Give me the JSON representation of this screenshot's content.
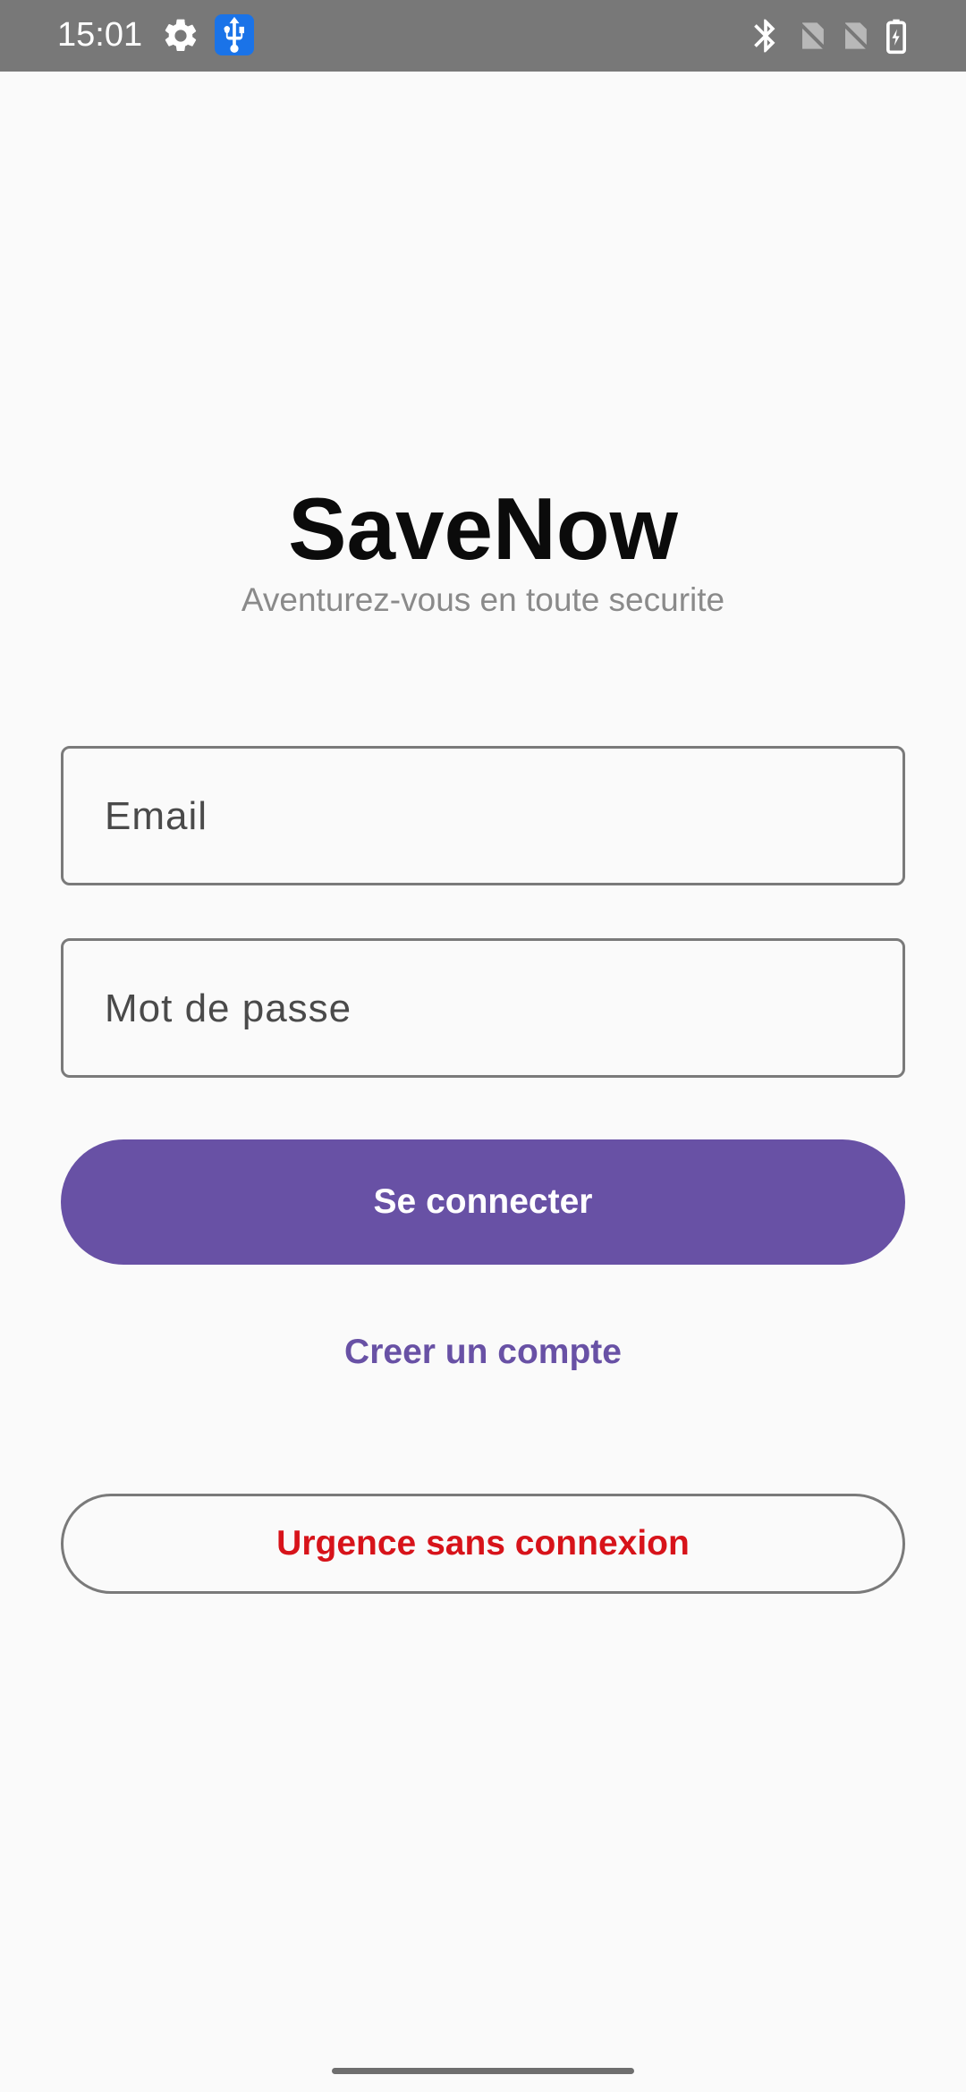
{
  "status_bar": {
    "time": "15:01",
    "icons": [
      "gear-icon",
      "usb-icon",
      "bluetooth-icon",
      "no-sim-icon",
      "no-sim-icon",
      "battery-charging-icon"
    ]
  },
  "app": {
    "title": "SaveNow",
    "subtitle": "Aventurez-vous en toute securite"
  },
  "form": {
    "email_placeholder": "Email",
    "password_placeholder": "Mot de passe",
    "login_label": "Se connecter",
    "create_account_label": "Creer un compte",
    "emergency_label": "Urgence sans connexion"
  },
  "colors": {
    "primary": "#6851a5",
    "emergency": "#d7131a",
    "background": "#fafafa",
    "status_bar": "#787878"
  }
}
